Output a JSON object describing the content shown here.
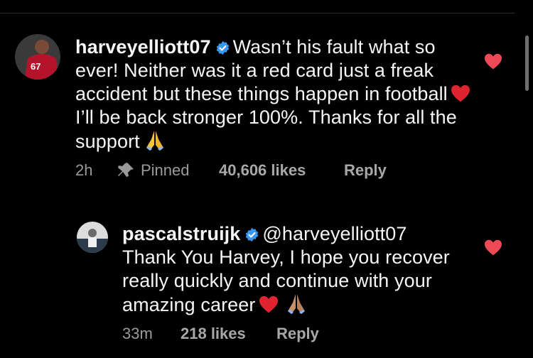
{
  "comments": [
    {
      "username": "harveyelliott07",
      "text_segments": [
        "Wasn’t his fault what so ever! Neither was it a red card just a freak accident but these things happen in football",
        "I’ll be back stronger 100%. Thanks for all the support"
      ],
      "time": "2h",
      "pinned_label": "Pinned",
      "likes": "40,606 likes",
      "reply_label": "Reply",
      "avatar_number": "67"
    },
    {
      "username": "pascalstruijk",
      "mention": "@harveyelliott07",
      "text": "Thank You Harvey, I hope you recover really quickly and continue with your amazing career",
      "time": "33m",
      "likes": "218 likes",
      "reply_label": "Reply"
    }
  ],
  "icons": {
    "verified": "verified-badge-icon",
    "heart": "heart-icon",
    "pin": "pin-icon",
    "pray": "folded-hands-emoji"
  },
  "colors": {
    "background": "#000000",
    "heart": "#ed4956",
    "verified": "#3897f0",
    "meta": "#9a9a9a"
  }
}
